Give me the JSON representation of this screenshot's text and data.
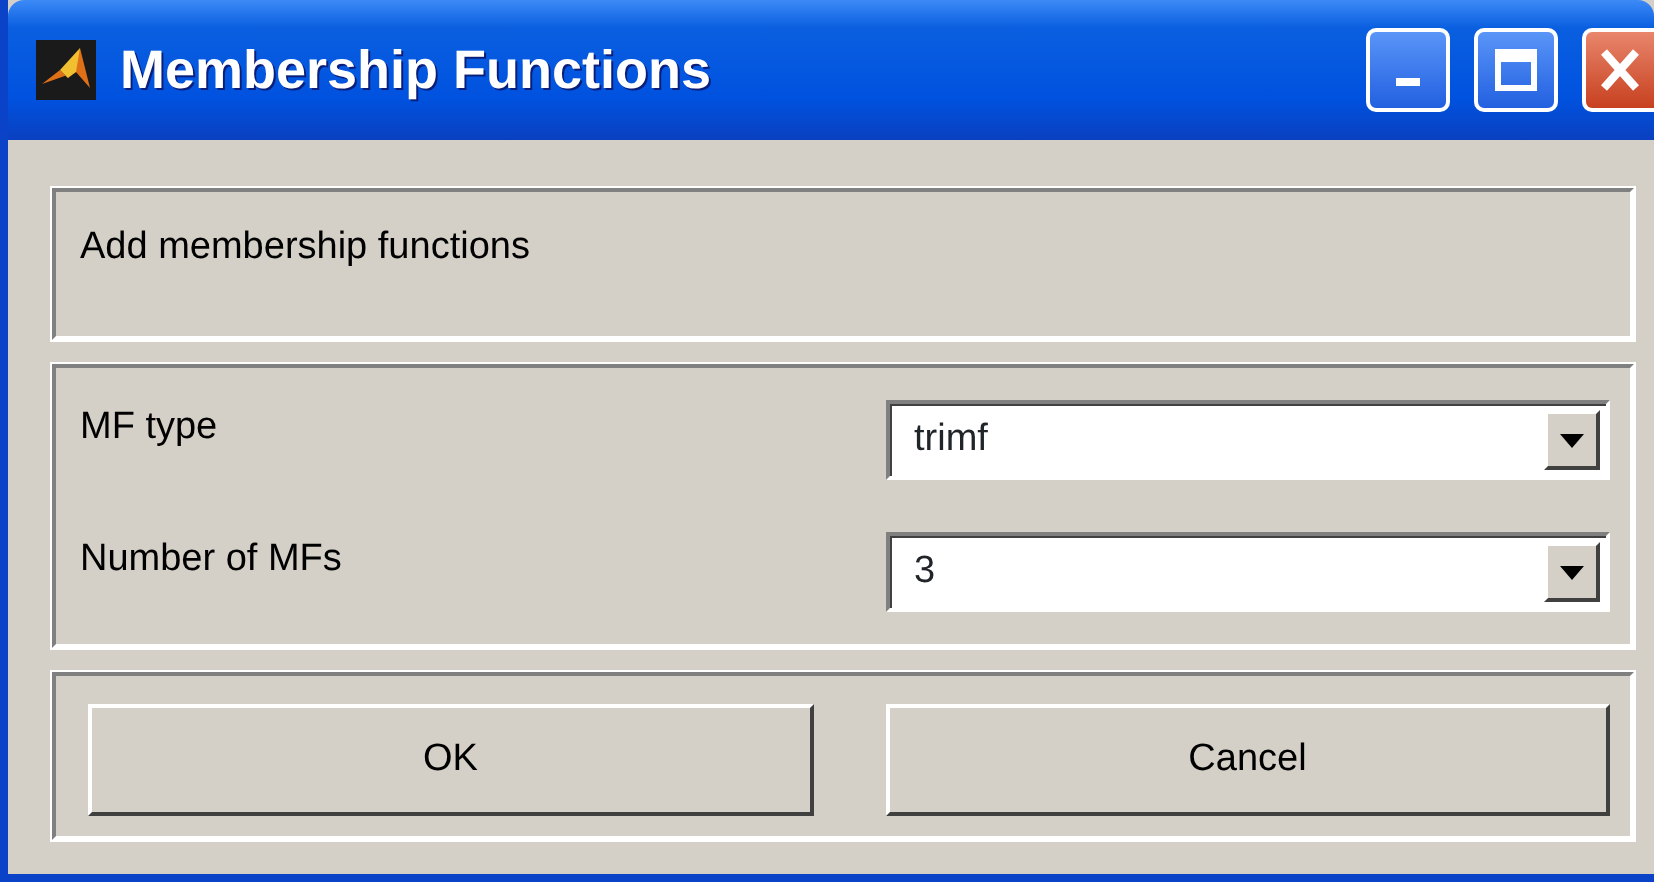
{
  "window": {
    "title": "Membership Functions"
  },
  "prompt": "Add membership functions",
  "fields": [
    {
      "label": "MF type",
      "value": "trimf"
    },
    {
      "label": "Number of MFs",
      "value": "3"
    }
  ],
  "buttons": [
    "OK",
    "Cancel"
  ]
}
